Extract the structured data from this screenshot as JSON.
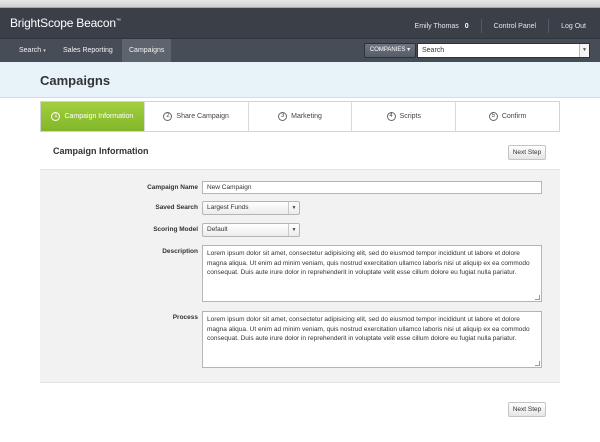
{
  "app": {
    "logo": "BrightScope Beacon",
    "logo_mark": "™"
  },
  "topnav": {
    "user_name": "Emily Thomas",
    "notification_count": "0",
    "control_panel": "Control Panel",
    "logout": "Log Out"
  },
  "navbar": {
    "items": [
      {
        "label": "Search",
        "has_dropdown": true,
        "active": false
      },
      {
        "label": "Sales Reporting",
        "active": false
      },
      {
        "label": "Campaigns",
        "active": true
      }
    ],
    "scope_button": "COMPANIES",
    "search_value": "Search"
  },
  "page": {
    "title": "Campaigns"
  },
  "steps": [
    {
      "number": "1",
      "label": "Campaign Information",
      "active": true
    },
    {
      "number": "2",
      "label": "Share Campaign",
      "active": false
    },
    {
      "number": "3",
      "label": "Marketing",
      "active": false
    },
    {
      "number": "4",
      "label": "Scripts",
      "active": false
    },
    {
      "number": "5",
      "label": "Confirm",
      "active": false
    }
  ],
  "section": {
    "title": "Campaign Information",
    "next_step_top": "Next Step",
    "next_step_bottom": "Next Step"
  },
  "form": {
    "campaign_name_label": "Campaign Name",
    "campaign_name_value": "New Campaign",
    "saved_search_label": "Saved Search",
    "saved_search_value": "Largest Funds",
    "scoring_model_label": "Scoring Model",
    "scoring_model_value": "Default",
    "description_label": "Description",
    "description_value": "Lorem ipsum dolor sit amet, consectetur adipisicing elit, sed do eiusmod tempor incididunt ut labore et dolore magna aliqua. Ut enim ad minim veniam, quis nostrud exercitation ullamco laboris nisi ut aliquip ex ea commodo consequat. Duis aute irure dolor in reprehenderit in voluptate velit esse cillum dolore eu fugiat nulla pariatur.",
    "process_label": "Process",
    "process_value": "Lorem ipsum dolor sit amet, consectetur adipisicing elit, sed do eiusmod tempor incididunt ut labore et dolore magna aliqua. Ut enim ad minim veniam, quis nostrud exercitation ullamco laboris nisi ut aliquip ex ea commodo consequat. Duis aute irure dolor in reprehenderit in voluptate velit esse cillum dolore eu fugiat nulla pariatur."
  },
  "colors": {
    "topbar": "#3a3f48",
    "navbar": "#474d57",
    "header_band": "#e7f2f9",
    "active_step": "#94c435"
  }
}
